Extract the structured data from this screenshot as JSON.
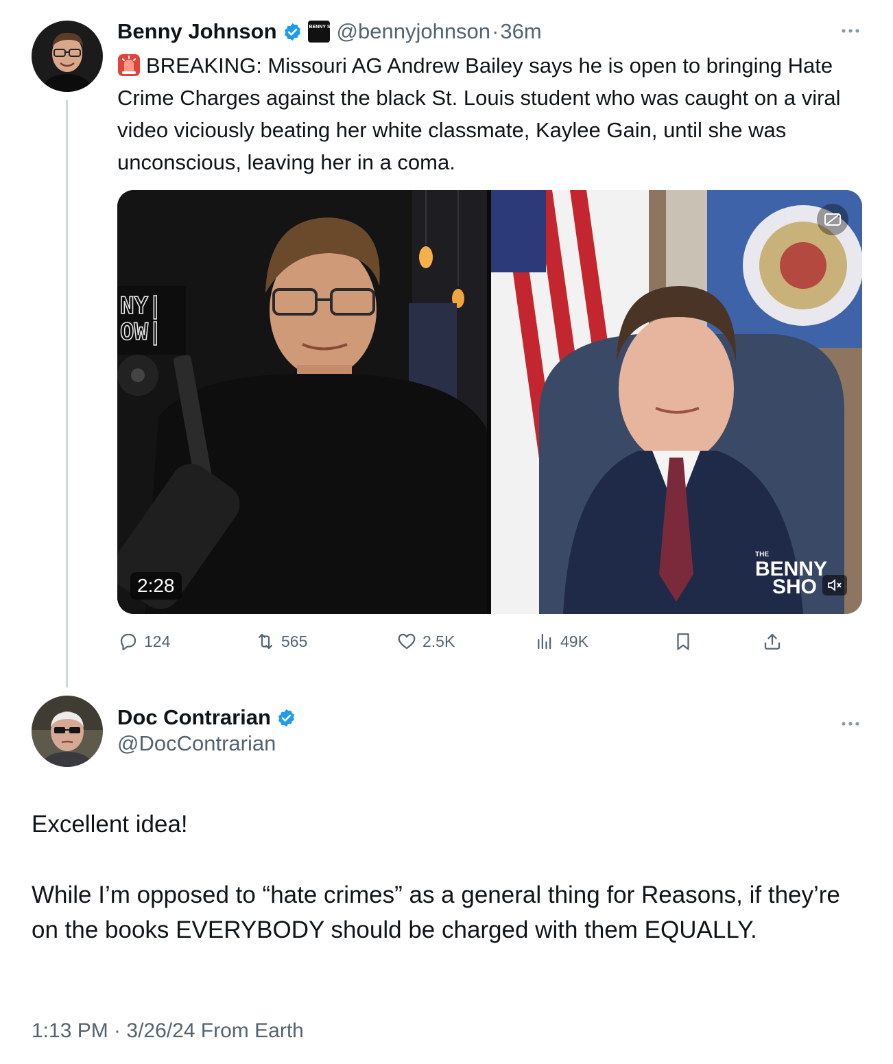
{
  "parent": {
    "author_name": "Benny Johnson",
    "handle": "@bennyjohnson",
    "separator": "·",
    "time": "36m",
    "org_badge_text": "BENNY SHOW",
    "text": "BREAKING: Missouri AG Andrew Bailey says he is open to bringing Hate Crime Charges against the black St. Louis student who was caught on a viral video viciously beating her white classmate, Kaylee Gain, until she was unconscious, leaving her in a coma.",
    "video": {
      "duration": "2:28",
      "left_sign": "NY\nOW",
      "watermark_small": "THE",
      "watermark_line1": "BENNY",
      "watermark_line2": "SHO"
    },
    "stats": {
      "replies": "124",
      "reposts": "565",
      "likes": "2.5K",
      "views": "49K"
    }
  },
  "reply": {
    "author_name": "Doc Contrarian",
    "handle": "@DocContrarian",
    "paragraph1": "Excellent idea!",
    "paragraph2": "While I’m opposed to “hate crimes” as a general thing for Reasons, if they’re on the books EVERYBODY should be charged with them EQUALLY.",
    "meta": "1:13 PM · 3/26/24 From Earth"
  },
  "colors": {
    "text": "#0f1419",
    "secondary": "#536471",
    "verified": "#1d9bf0",
    "thread_line": "#cfd9de"
  },
  "icons": [
    "verified-badge-icon",
    "siren-emoji-icon",
    "more-icon",
    "reply-icon",
    "repost-icon",
    "like-icon",
    "views-icon",
    "bookmark-icon",
    "share-icon",
    "captions-icon",
    "muted-icon"
  ]
}
